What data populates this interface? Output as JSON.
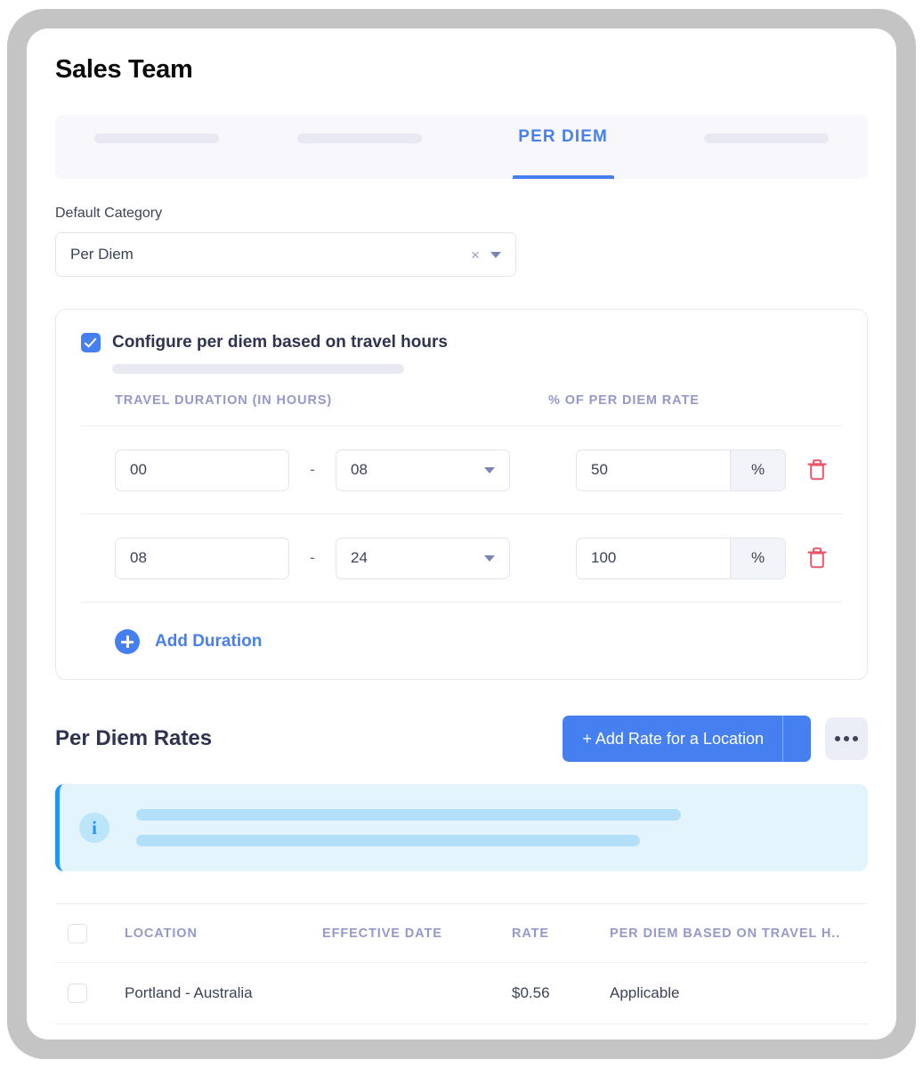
{
  "page_title": "Sales Team",
  "tabs": [
    {
      "label": "",
      "type": "skeleton",
      "active": false,
      "name": "tab-placeholder-1"
    },
    {
      "label": "",
      "type": "skeleton",
      "active": false,
      "name": "tab-placeholder-2"
    },
    {
      "label": "PER DIEM",
      "type": "text",
      "active": true,
      "name": "tab-per-diem"
    },
    {
      "label": "",
      "type": "skeleton",
      "active": false,
      "name": "tab-placeholder-3"
    }
  ],
  "default_category": {
    "label": "Default Category",
    "value": "Per Diem",
    "clear_icon": "close-icon",
    "dropdown_icon": "chevron-down-icon"
  },
  "config": {
    "checkbox_checked": true,
    "title": "Configure per diem based on travel hours",
    "columns": {
      "duration": "TRAVEL DURATION (IN HOURS)",
      "percent": "% OF PER DIEM RATE"
    },
    "separator": "-",
    "percent_suffix": "%",
    "rows": [
      {
        "from": "00",
        "to": "08",
        "percent": "50"
      },
      {
        "from": "08",
        "to": "24",
        "percent": "100"
      }
    ],
    "add_duration_label": "Add Duration",
    "add_icon": "plus-circle-icon",
    "delete_icon": "trash-icon"
  },
  "rates": {
    "title": "Per Diem Rates",
    "add_button_label": "+ Add Rate for a Location",
    "more_button_icon": "ellipsis-icon",
    "info_icon": "info-icon",
    "table": {
      "headers": [
        "LOCATION",
        "EFFECTIVE DATE",
        "RATE",
        "PER DIEM BASED ON TRAVEL H.."
      ],
      "rows": [
        {
          "location": "Portland - Australia",
          "effective_date": "",
          "rate": "$0.56",
          "based_on_travel": "Applicable"
        }
      ]
    }
  },
  "colors": {
    "accent": "#4680f0",
    "danger": "#e8586d",
    "info": "#2196f3",
    "muted_label": "#9499c9",
    "text": "#3c4257"
  }
}
